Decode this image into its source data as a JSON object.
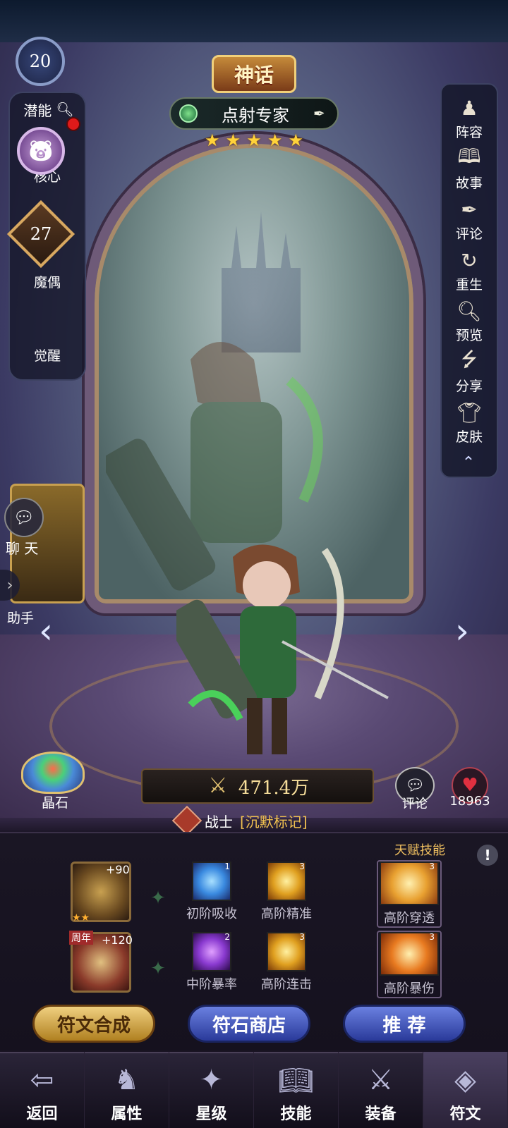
{
  "header": {
    "tier": "神话",
    "hero_name": "点射专家",
    "stars": 5
  },
  "left_panel": {
    "potential_label": "潜能",
    "core_level": "20",
    "core_label": "核心",
    "puppet_label": "魔偶",
    "awaken_level": "27",
    "awaken_label": "觉醒"
  },
  "right_panel": {
    "items": [
      {
        "label": "阵容",
        "icon": "lineup-icon"
      },
      {
        "label": "故事",
        "icon": "book-icon"
      },
      {
        "label": "评论",
        "icon": "quill-icon"
      },
      {
        "label": "重生",
        "icon": "rebirth-icon"
      },
      {
        "label": "预览",
        "icon": "magnifier-icon"
      },
      {
        "label": "分享",
        "icon": "share-icon"
      },
      {
        "label": "皮肤",
        "icon": "skin-icon"
      }
    ]
  },
  "side": {
    "chat_label": "聊 天",
    "helper_label": "助手"
  },
  "stage": {
    "crystal_label": "晶石",
    "power": "471.4万",
    "class_name": "战士",
    "class_tag": "[沉默标记]",
    "comment_label": "评论",
    "likes": "18963"
  },
  "runes": {
    "talent_label": "天赋技能",
    "slot1_bonus": "+90",
    "slot2_bonus": "+120",
    "anniversary_tag": "周年",
    "skills": [
      {
        "name": "初阶吸收",
        "level": "1",
        "color": "#3a8ae0"
      },
      {
        "name": "高阶精准",
        "level": "3",
        "color": "#e0a020"
      },
      {
        "name": "高阶穿透",
        "level": "3",
        "color": "#e8a030"
      },
      {
        "name": "中阶暴率",
        "level": "2",
        "color": "#8a3ad0"
      },
      {
        "name": "高阶连击",
        "level": "3",
        "color": "#e0a020"
      },
      {
        "name": "高阶暴伤",
        "level": "3",
        "color": "#e87a20"
      }
    ]
  },
  "buttons": {
    "synthesize": "符文合成",
    "shop": "符石商店",
    "recommend": "推 荐"
  },
  "bottom_nav": {
    "items": [
      {
        "label": "返回",
        "icon": "back-icon"
      },
      {
        "label": "属性",
        "icon": "attributes-icon"
      },
      {
        "label": "星级",
        "icon": "star-level-icon"
      },
      {
        "label": "技能",
        "icon": "skill-book-icon"
      },
      {
        "label": "装备",
        "icon": "equipment-icon"
      },
      {
        "label": "符文",
        "icon": "rune-icon"
      }
    ],
    "active": "符文"
  }
}
